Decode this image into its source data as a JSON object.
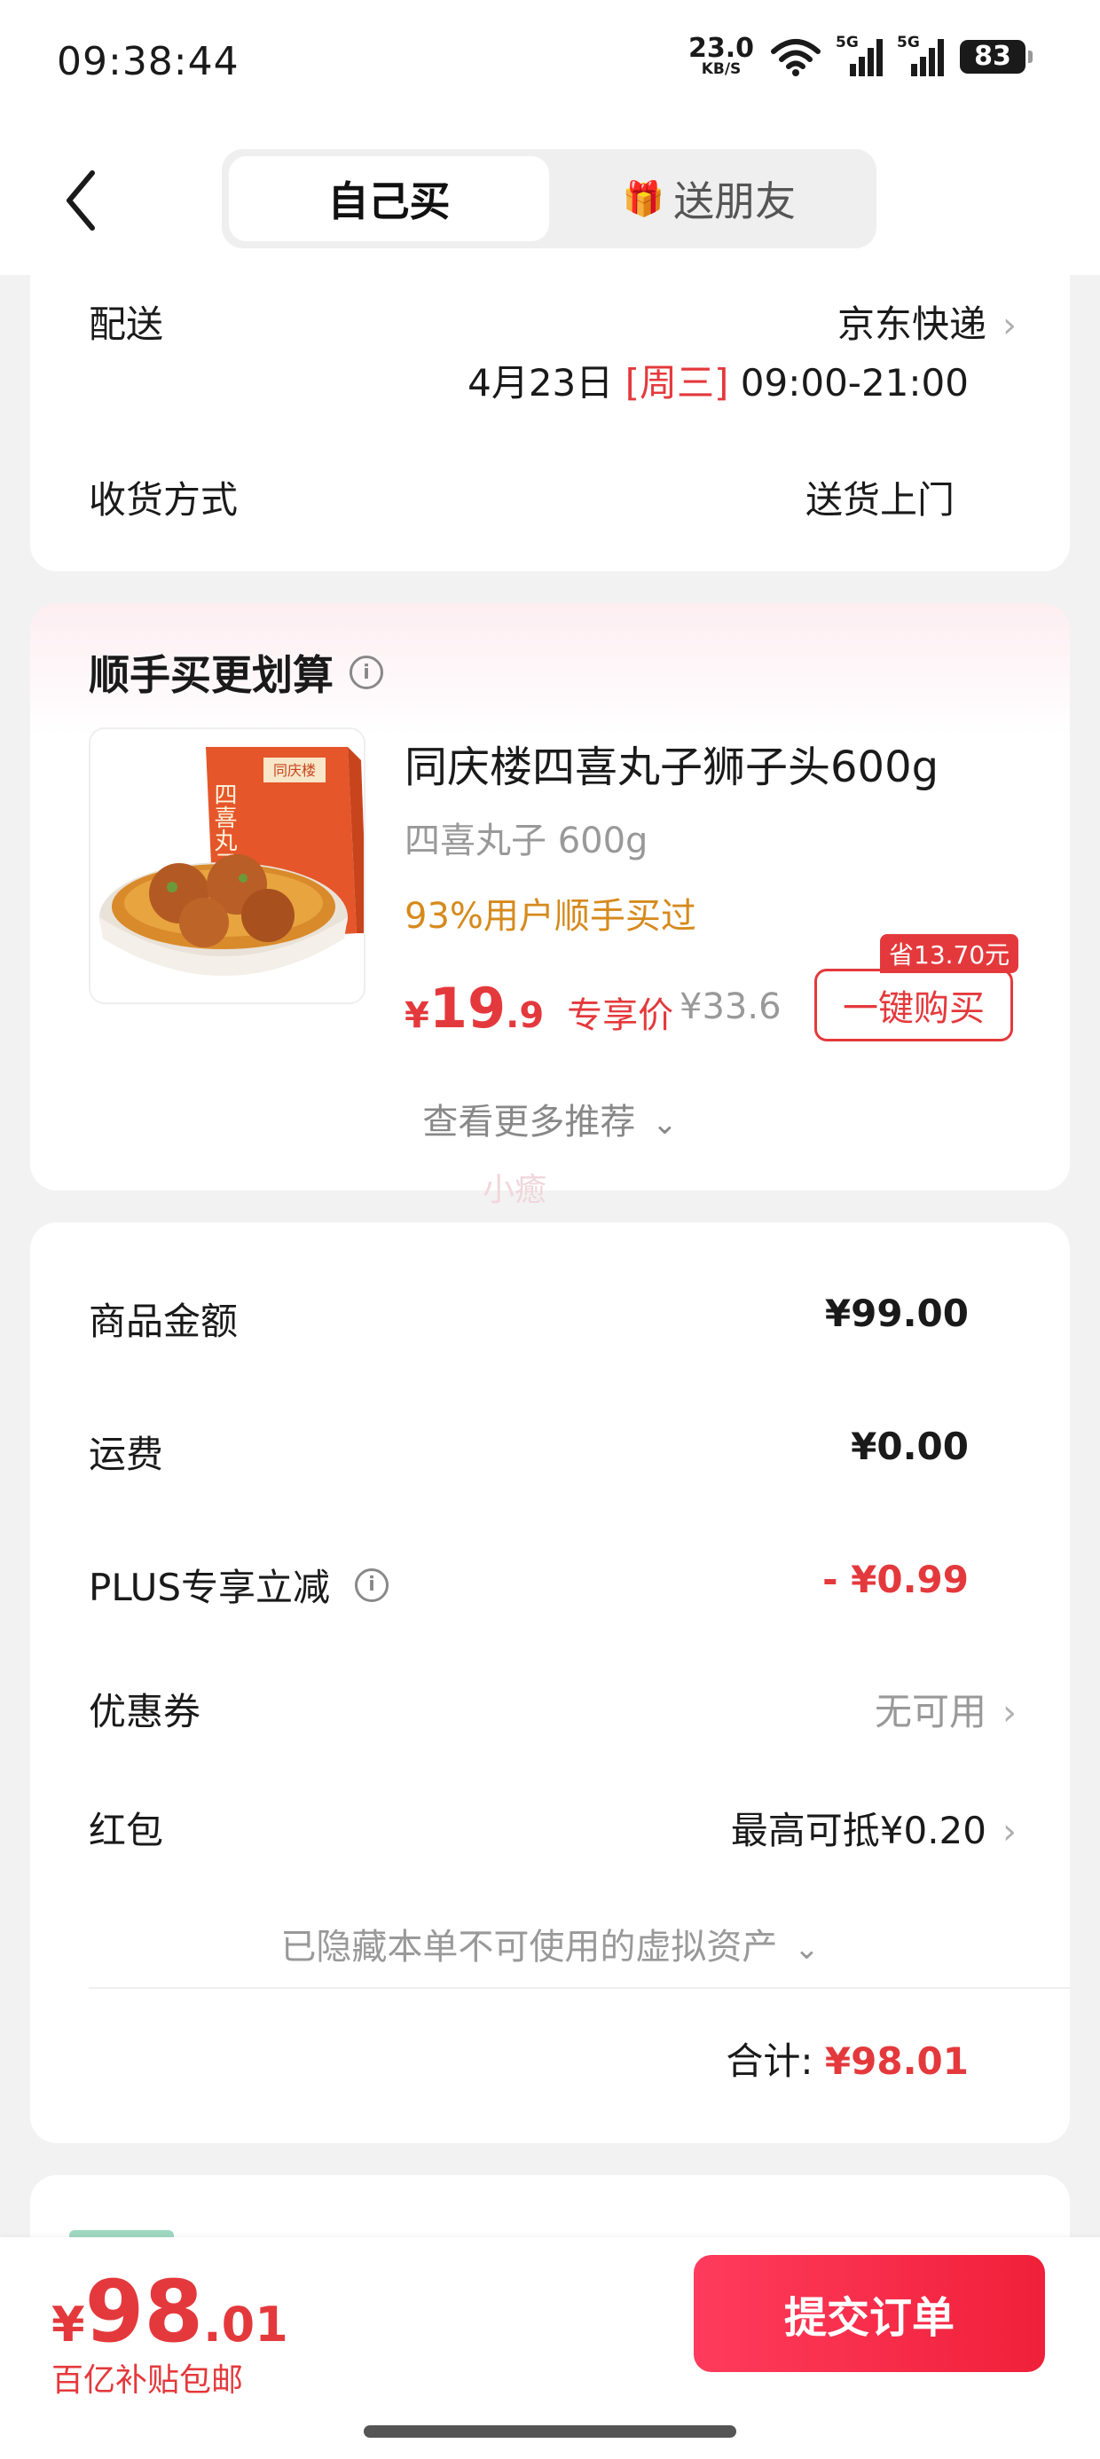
{
  "status_bar": {
    "time": "09:38:44",
    "net_speed": "23.0",
    "net_unit": "KB/S",
    "signal1": "5G",
    "signal2": "5G",
    "battery": "83"
  },
  "header": {
    "back_icon": "chevron-left-icon",
    "tabs": [
      {
        "label": "自己买",
        "active": true
      },
      {
        "label": "送朋友",
        "active": false,
        "icon": "gift-icon"
      }
    ],
    "gift_glyph": "🎁"
  },
  "delivery": {
    "label": "配送",
    "carrier": "京东快递",
    "date": "4月23日",
    "weekday": "[周三]",
    "time_window": "09:00-21:00",
    "method_label": "收货方式",
    "method_value": "送货上门"
  },
  "addon": {
    "title": "顺手买更划算",
    "product": {
      "name": "同庆楼四喜丸子狮子头600g",
      "spec": "四喜丸子 600g",
      "hint": "93%用户顺手买过",
      "price_yen": "¥",
      "price_int": "19",
      "price_dec": ".9",
      "price_tag": "专享价",
      "original_price": "¥33.6",
      "save_badge": "省13.70元",
      "buy_label": "一键购买",
      "box_brand": "同庆楼",
      "box_text": "四喜丸子"
    },
    "more_label": "查看更多推荐",
    "watermark": "小癒"
  },
  "summary": {
    "rows": [
      {
        "label": "商品金额",
        "value": "¥99.00"
      },
      {
        "label": "运费",
        "value": "¥0.00"
      },
      {
        "label": "PLUS专享立减",
        "value": "- ¥0.99"
      },
      {
        "label": "优惠券",
        "value": "无可用"
      },
      {
        "label": "红包",
        "value": "最高可抵¥0.20"
      }
    ],
    "hidden_assets": "已隐藏本单不可使用的虚拟资产",
    "total_label": "合计:",
    "total_value": "¥98.01"
  },
  "bottom": {
    "yen": "¥",
    "total_int": "98",
    "total_dec": ".01",
    "subsidy": "百亿补贴包邮",
    "submit_label": "提交订单"
  },
  "colors": {
    "accent": "#e4393c",
    "hint": "#d68a1c",
    "muted": "#999999"
  }
}
